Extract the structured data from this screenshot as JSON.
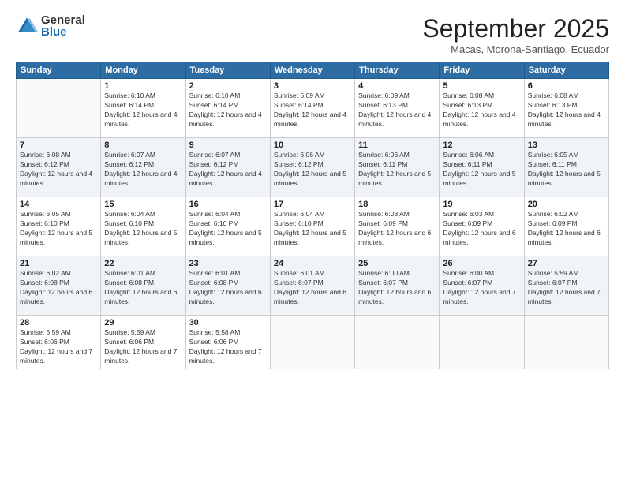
{
  "logo": {
    "general": "General",
    "blue": "Blue"
  },
  "title": "September 2025",
  "location": "Macas, Morona-Santiago, Ecuador",
  "days": [
    "Sunday",
    "Monday",
    "Tuesday",
    "Wednesday",
    "Thursday",
    "Friday",
    "Saturday"
  ],
  "weeks": [
    [
      {
        "num": "",
        "sunrise": "",
        "sunset": "",
        "daylight": ""
      },
      {
        "num": "1",
        "sunrise": "Sunrise: 6:10 AM",
        "sunset": "Sunset: 6:14 PM",
        "daylight": "Daylight: 12 hours and 4 minutes."
      },
      {
        "num": "2",
        "sunrise": "Sunrise: 6:10 AM",
        "sunset": "Sunset: 6:14 PM",
        "daylight": "Daylight: 12 hours and 4 minutes."
      },
      {
        "num": "3",
        "sunrise": "Sunrise: 6:09 AM",
        "sunset": "Sunset: 6:14 PM",
        "daylight": "Daylight: 12 hours and 4 minutes."
      },
      {
        "num": "4",
        "sunrise": "Sunrise: 6:09 AM",
        "sunset": "Sunset: 6:13 PM",
        "daylight": "Daylight: 12 hours and 4 minutes."
      },
      {
        "num": "5",
        "sunrise": "Sunrise: 6:08 AM",
        "sunset": "Sunset: 6:13 PM",
        "daylight": "Daylight: 12 hours and 4 minutes."
      },
      {
        "num": "6",
        "sunrise": "Sunrise: 6:08 AM",
        "sunset": "Sunset: 6:13 PM",
        "daylight": "Daylight: 12 hours and 4 minutes."
      }
    ],
    [
      {
        "num": "7",
        "sunrise": "Sunrise: 6:08 AM",
        "sunset": "Sunset: 6:12 PM",
        "daylight": "Daylight: 12 hours and 4 minutes."
      },
      {
        "num": "8",
        "sunrise": "Sunrise: 6:07 AM",
        "sunset": "Sunset: 6:12 PM",
        "daylight": "Daylight: 12 hours and 4 minutes."
      },
      {
        "num": "9",
        "sunrise": "Sunrise: 6:07 AM",
        "sunset": "Sunset: 6:12 PM",
        "daylight": "Daylight: 12 hours and 4 minutes."
      },
      {
        "num": "10",
        "sunrise": "Sunrise: 6:06 AM",
        "sunset": "Sunset: 6:12 PM",
        "daylight": "Daylight: 12 hours and 5 minutes."
      },
      {
        "num": "11",
        "sunrise": "Sunrise: 6:06 AM",
        "sunset": "Sunset: 6:11 PM",
        "daylight": "Daylight: 12 hours and 5 minutes."
      },
      {
        "num": "12",
        "sunrise": "Sunrise: 6:06 AM",
        "sunset": "Sunset: 6:11 PM",
        "daylight": "Daylight: 12 hours and 5 minutes."
      },
      {
        "num": "13",
        "sunrise": "Sunrise: 6:05 AM",
        "sunset": "Sunset: 6:11 PM",
        "daylight": "Daylight: 12 hours and 5 minutes."
      }
    ],
    [
      {
        "num": "14",
        "sunrise": "Sunrise: 6:05 AM",
        "sunset": "Sunset: 6:10 PM",
        "daylight": "Daylight: 12 hours and 5 minutes."
      },
      {
        "num": "15",
        "sunrise": "Sunrise: 6:04 AM",
        "sunset": "Sunset: 6:10 PM",
        "daylight": "Daylight: 12 hours and 5 minutes."
      },
      {
        "num": "16",
        "sunrise": "Sunrise: 6:04 AM",
        "sunset": "Sunset: 6:10 PM",
        "daylight": "Daylight: 12 hours and 5 minutes."
      },
      {
        "num": "17",
        "sunrise": "Sunrise: 6:04 AM",
        "sunset": "Sunset: 6:10 PM",
        "daylight": "Daylight: 12 hours and 5 minutes."
      },
      {
        "num": "18",
        "sunrise": "Sunrise: 6:03 AM",
        "sunset": "Sunset: 6:09 PM",
        "daylight": "Daylight: 12 hours and 6 minutes."
      },
      {
        "num": "19",
        "sunrise": "Sunrise: 6:03 AM",
        "sunset": "Sunset: 6:09 PM",
        "daylight": "Daylight: 12 hours and 6 minutes."
      },
      {
        "num": "20",
        "sunrise": "Sunrise: 6:02 AM",
        "sunset": "Sunset: 6:09 PM",
        "daylight": "Daylight: 12 hours and 6 minutes."
      }
    ],
    [
      {
        "num": "21",
        "sunrise": "Sunrise: 6:02 AM",
        "sunset": "Sunset: 6:08 PM",
        "daylight": "Daylight: 12 hours and 6 minutes."
      },
      {
        "num": "22",
        "sunrise": "Sunrise: 6:01 AM",
        "sunset": "Sunset: 6:08 PM",
        "daylight": "Daylight: 12 hours and 6 minutes."
      },
      {
        "num": "23",
        "sunrise": "Sunrise: 6:01 AM",
        "sunset": "Sunset: 6:08 PM",
        "daylight": "Daylight: 12 hours and 6 minutes."
      },
      {
        "num": "24",
        "sunrise": "Sunrise: 6:01 AM",
        "sunset": "Sunset: 6:07 PM",
        "daylight": "Daylight: 12 hours and 6 minutes."
      },
      {
        "num": "25",
        "sunrise": "Sunrise: 6:00 AM",
        "sunset": "Sunset: 6:07 PM",
        "daylight": "Daylight: 12 hours and 6 minutes."
      },
      {
        "num": "26",
        "sunrise": "Sunrise: 6:00 AM",
        "sunset": "Sunset: 6:07 PM",
        "daylight": "Daylight: 12 hours and 7 minutes."
      },
      {
        "num": "27",
        "sunrise": "Sunrise: 5:59 AM",
        "sunset": "Sunset: 6:07 PM",
        "daylight": "Daylight: 12 hours and 7 minutes."
      }
    ],
    [
      {
        "num": "28",
        "sunrise": "Sunrise: 5:59 AM",
        "sunset": "Sunset: 6:06 PM",
        "daylight": "Daylight: 12 hours and 7 minutes."
      },
      {
        "num": "29",
        "sunrise": "Sunrise: 5:59 AM",
        "sunset": "Sunset: 6:06 PM",
        "daylight": "Daylight: 12 hours and 7 minutes."
      },
      {
        "num": "30",
        "sunrise": "Sunrise: 5:58 AM",
        "sunset": "Sunset: 6:06 PM",
        "daylight": "Daylight: 12 hours and 7 minutes."
      },
      {
        "num": "",
        "sunrise": "",
        "sunset": "",
        "daylight": ""
      },
      {
        "num": "",
        "sunrise": "",
        "sunset": "",
        "daylight": ""
      },
      {
        "num": "",
        "sunrise": "",
        "sunset": "",
        "daylight": ""
      },
      {
        "num": "",
        "sunrise": "",
        "sunset": "",
        "daylight": ""
      }
    ]
  ]
}
